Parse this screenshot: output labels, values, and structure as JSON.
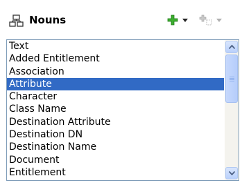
{
  "panel": {
    "title": "Nouns",
    "icons": {
      "title": "hierarchy-icon",
      "add": "plus-icon",
      "add_menu": "dropdown-arrow-icon",
      "insert": "insert-plus-icon",
      "insert_menu": "dropdown-arrow-icon"
    }
  },
  "list": {
    "items": [
      "Text",
      "Added Entitlement",
      "Association",
      "Attribute",
      "Character",
      "Class Name",
      "Destination Attribute",
      "Destination DN",
      "Destination Name",
      "Document",
      "Entitlement"
    ],
    "selected_index": 3
  },
  "colors": {
    "selection": "#316ac5",
    "add_icon": "#3cae2f",
    "border": "#7f9db9"
  }
}
